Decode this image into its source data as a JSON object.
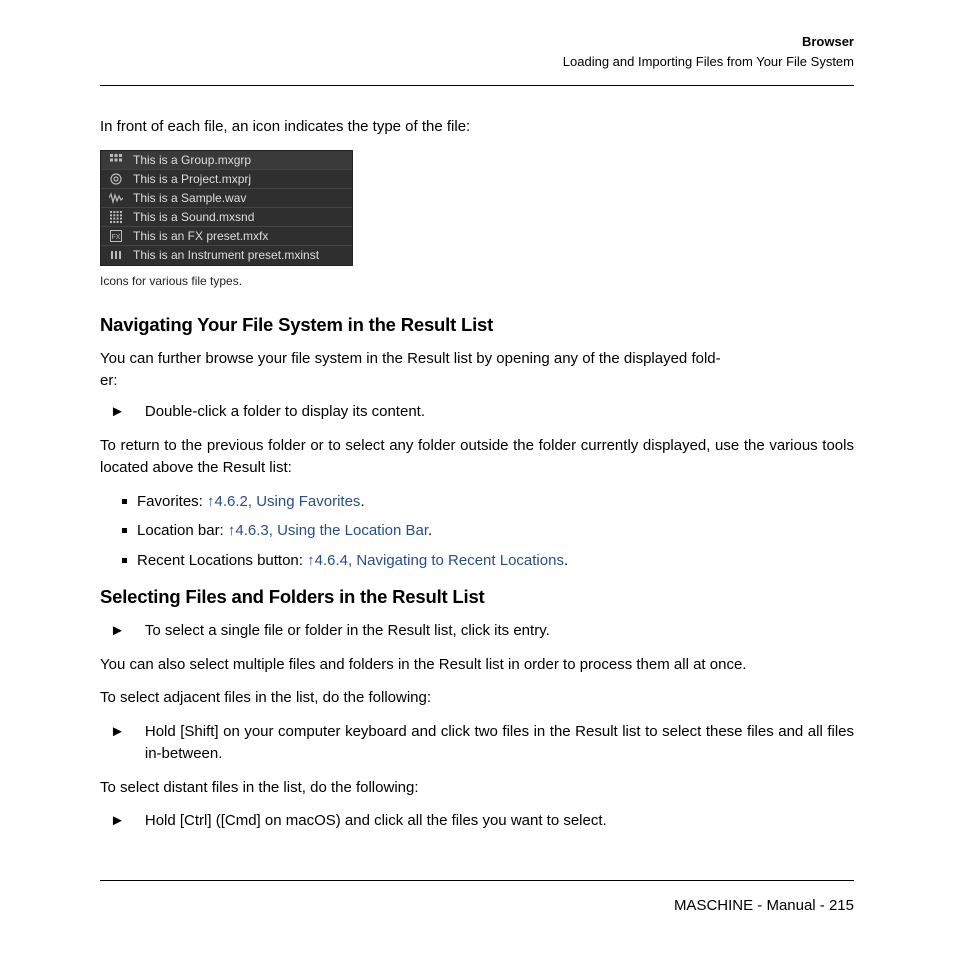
{
  "header": {
    "title": "Browser",
    "subtitle": "Loading and Importing Files from Your File System"
  },
  "intro": "In front of each file, an icon indicates the type of the file:",
  "file_list": {
    "rows": [
      {
        "label": "This is a Group.mxgrp"
      },
      {
        "label": "This is a Project.mxprj"
      },
      {
        "label": "This is a Sample.wav"
      },
      {
        "label": "This is a Sound.mxsnd"
      },
      {
        "label": "This is an FX preset.mxfx"
      },
      {
        "label": "This is an Instrument preset.mxinst"
      }
    ],
    "caption": "Icons for various file types."
  },
  "sections": {
    "nav": {
      "title": "Navigating Your File System in the Result List",
      "p1a": "You can further browse your file system in the Result list by opening any of the displayed fold",
      "p1b": "er:",
      "arrow1": "Double-click a folder to display its content.",
      "p2": "To return to the previous folder or to select any folder outside the folder currently displayed, use the various tools located above the Result list:",
      "bullets": [
        {
          "prefix": "Favorites: ",
          "link": "↑4.6.2, Using Favorites",
          "suffix": "."
        },
        {
          "prefix": "Location bar: ",
          "link": "↑4.6.3, Using the Location Bar",
          "suffix": "."
        },
        {
          "prefix": "Recent Locations button: ",
          "link": "↑4.6.4, Navigating to Recent Locations",
          "suffix": "."
        }
      ]
    },
    "select": {
      "title": "Selecting Files and Folders in the Result List",
      "arrow1": "To select a single file or folder in the Result list, click its entry.",
      "p1": "You can also select multiple files and folders in the Result list in order to process them all at once.",
      "p2": "To select adjacent files in the list, do the following:",
      "arrow2": "Hold [Shift] on your computer keyboard and click two files in the Result list to select these files and all files in-between.",
      "p3": "To select distant files in the list, do the following:",
      "arrow3": "Hold [Ctrl] ([Cmd] on macOS) and click all the files you want to select."
    }
  },
  "footer": "MASCHINE - Manual - 215"
}
